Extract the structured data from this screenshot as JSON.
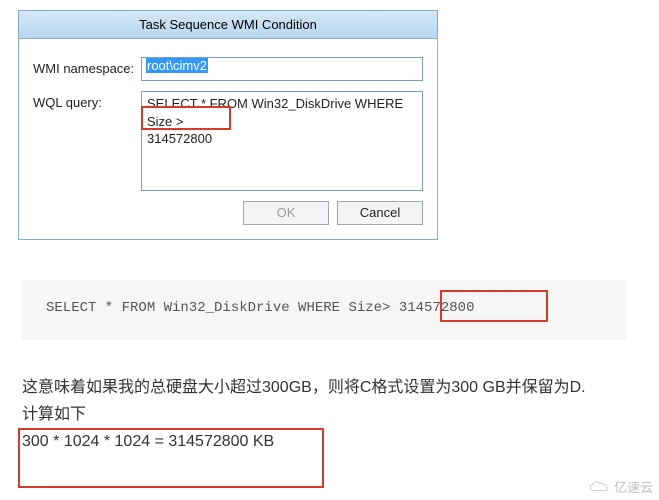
{
  "dialog": {
    "title": "Task Sequence WMI Condition",
    "ns_label": "WMI namespace:",
    "ns_value": "root\\cimv2",
    "query_label": "WQL query:",
    "query_value_line1": "SELECT * FROM Win32_DiskDrive WHERE Size >",
    "query_value_line2": "314572800",
    "ok_label": "OK",
    "cancel_label": "Cancel"
  },
  "codeblock": {
    "text": "SELECT * FROM Win32_DiskDrive WHERE Size> 314572800"
  },
  "article": {
    "line1": "这意味着如果我的总硬盘大小超过300GB，则将C格式设置为300 GB并保留为D.",
    "line2": "计算如下",
    "line3": "300 * 1024 * 1024 = 314572800 KB"
  },
  "watermark": {
    "text": "亿速云"
  }
}
